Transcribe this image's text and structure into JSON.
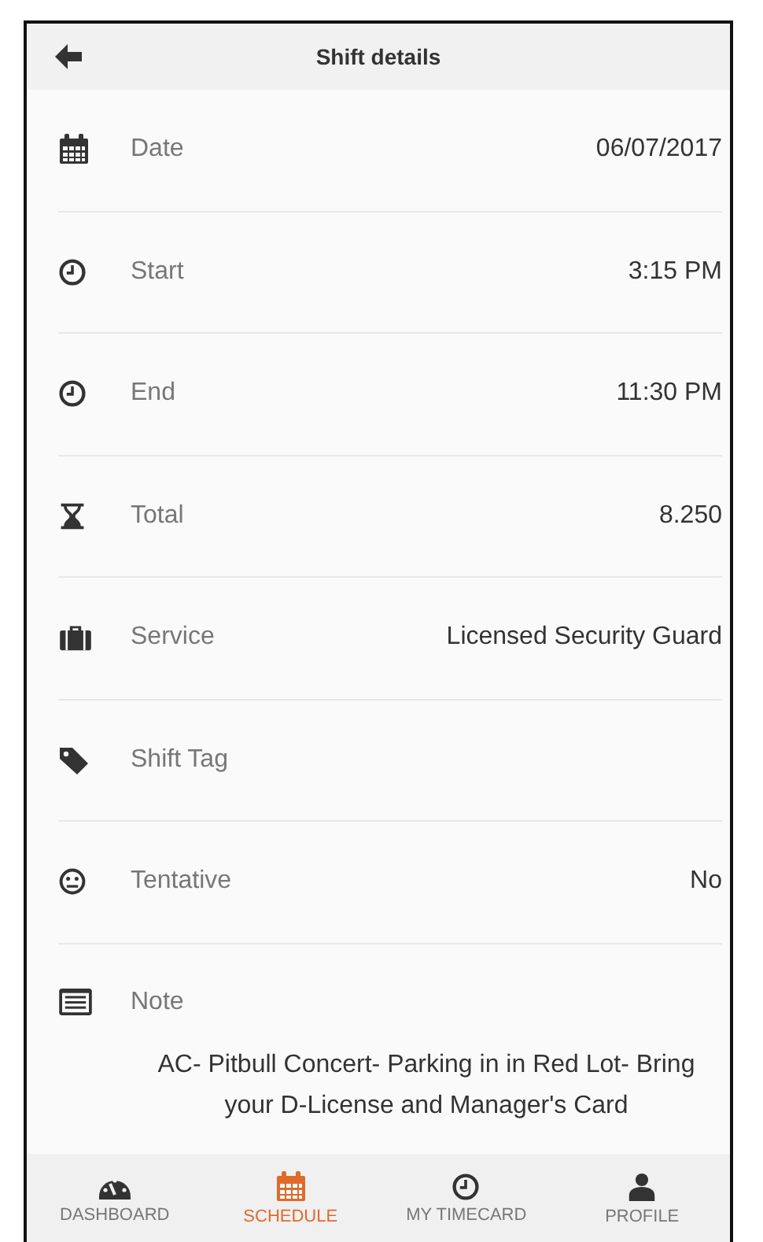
{
  "header": {
    "title": "Shift details"
  },
  "rows": [
    {
      "label": "Date",
      "value": "06/07/2017"
    },
    {
      "label": "Start",
      "value": "3:15 PM"
    },
    {
      "label": "End",
      "value": "11:30 PM"
    },
    {
      "label": "Total",
      "value": "8.250"
    },
    {
      "label": "Service",
      "value": "Licensed Security Guard"
    },
    {
      "label": "Shift Tag"
    },
    {
      "label": "Tentative",
      "value": "No"
    }
  ],
  "note": {
    "label": "Note",
    "text": "AC- Pitbull Concert- Parking in in Red Lot- Bring your D-License and Manager's Card"
  },
  "nav": [
    {
      "label": "DASHBOARD",
      "selected": false
    },
    {
      "label": "SCHEDULE",
      "selected": true
    },
    {
      "label": "MY TIMECARD",
      "selected": false
    },
    {
      "label": "PROFILE",
      "selected": false
    }
  ]
}
